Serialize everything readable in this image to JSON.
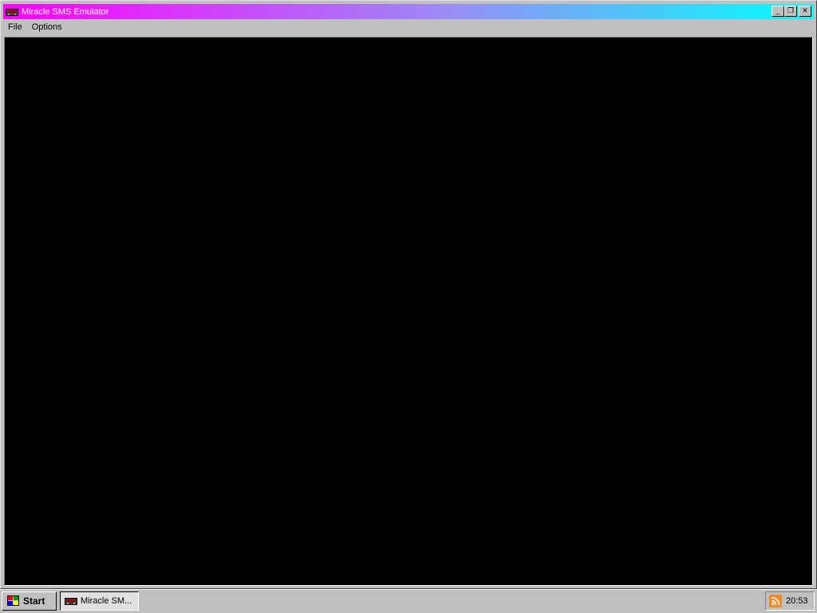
{
  "window": {
    "title": "Miracle SMS Emulator",
    "icon": "console-icon",
    "controls": {
      "minimize_glyph": "_",
      "restore_glyph": "❐",
      "close_glyph": "✕"
    },
    "title_gradient": [
      "#ff00ff",
      "#00ffff"
    ]
  },
  "menubar": {
    "items": [
      {
        "label": "File"
      },
      {
        "label": "Options"
      }
    ]
  },
  "display": {
    "background": "#000000"
  },
  "taskbar": {
    "start_label": "Start",
    "start_icon": "windows-flag-icon",
    "task_label": "Miracle SM...",
    "task_icon": "console-icon",
    "tray_icon": "rss-feed-icon",
    "clock": "20:53"
  }
}
